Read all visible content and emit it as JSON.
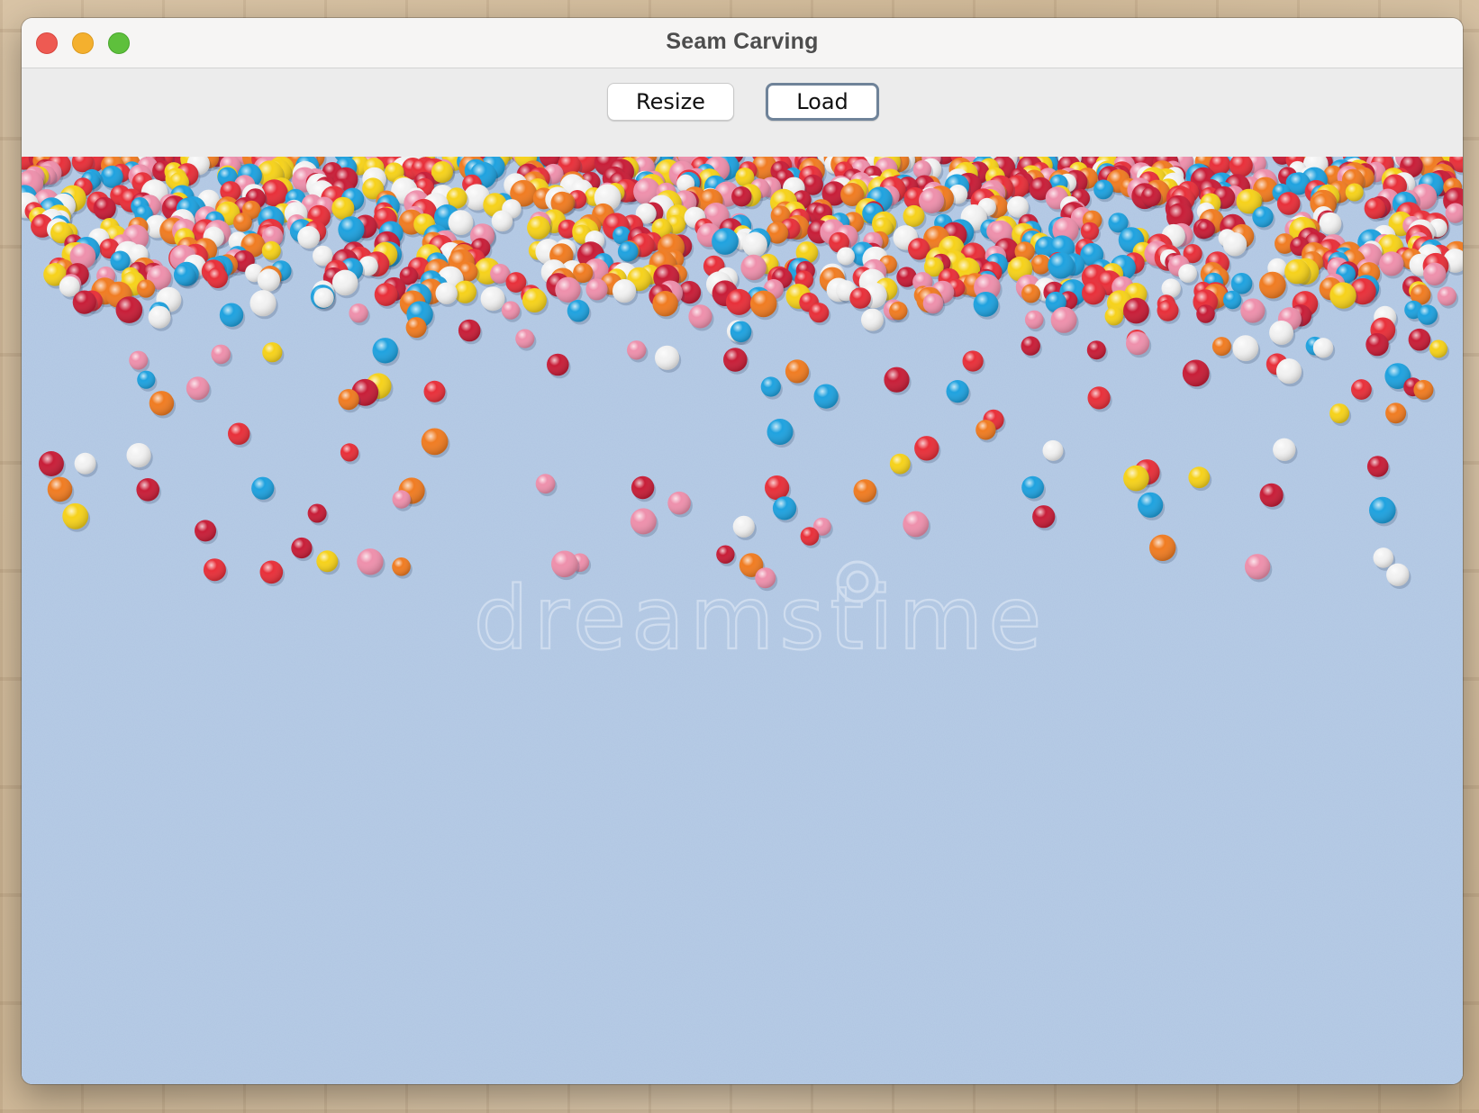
{
  "window": {
    "title": "Seam Carving",
    "traffic_lights": [
      "close",
      "minimize",
      "zoom"
    ]
  },
  "toolbar": {
    "resize_label": "Resize",
    "load_label": "Load",
    "focused_button": "Load"
  },
  "image": {
    "watermark": "dreamstime",
    "background_color": "#b7cce6",
    "sprinkle_colors": [
      "#e8303a",
      "#f6d21b",
      "#1fa2df",
      "#f07c22",
      "#f2f2f2",
      "#ee90ac",
      "#c81e38"
    ]
  }
}
